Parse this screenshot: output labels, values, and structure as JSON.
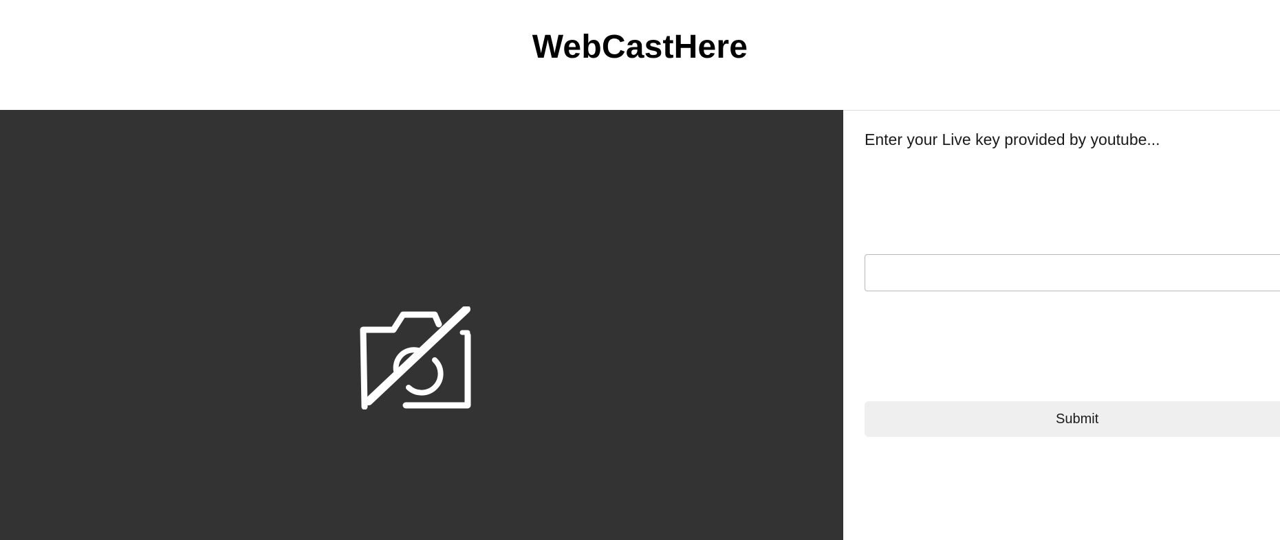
{
  "app": {
    "title": "WebCastHere"
  },
  "video": {
    "icon": "camera-off-icon",
    "background_color": "#333333",
    "icon_color": "#ffffff"
  },
  "stream_form": {
    "prompt": "Enter your Live key provided by youtube...",
    "key_value": "",
    "key_placeholder": "",
    "submit_label": "Submit"
  }
}
